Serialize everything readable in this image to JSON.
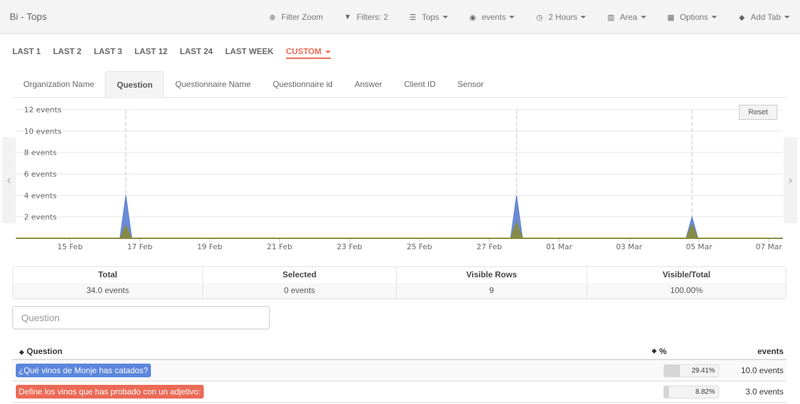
{
  "app": {
    "title": "Bi - Tops"
  },
  "topnav": [
    {
      "icon": "search-plus-icon",
      "glyph": "⊕",
      "label": "Filter Zoom",
      "dropdown": false
    },
    {
      "icon": "filter-icon",
      "glyph": "▼",
      "label": "Filters: 2",
      "dropdown": false
    },
    {
      "icon": "list-icon",
      "glyph": "☰",
      "label": "Tops",
      "dropdown": true
    },
    {
      "icon": "dashboard-icon",
      "glyph": "◉",
      "label": "events",
      "dropdown": true
    },
    {
      "icon": "clock-icon",
      "glyph": "◷",
      "label": "2 Hours",
      "dropdown": true
    },
    {
      "icon": "bar-chart-icon",
      "glyph": "▥",
      "label": "Area",
      "dropdown": true
    },
    {
      "icon": "grid-icon",
      "glyph": "▦",
      "label": "Options",
      "dropdown": true
    },
    {
      "icon": "tags-icon",
      "glyph": "◆",
      "label": "Add Tab",
      "dropdown": true
    }
  ],
  "quick_ranges": [
    {
      "label": "LAST 1",
      "active": false
    },
    {
      "label": "LAST 2",
      "active": false
    },
    {
      "label": "LAST 3",
      "active": false
    },
    {
      "label": "LAST 12",
      "active": false
    },
    {
      "label": "LAST 24",
      "active": false
    },
    {
      "label": "LAST WEEK",
      "active": false
    },
    {
      "label": "CUSTOM",
      "active": true
    }
  ],
  "tabs": [
    {
      "label": "Organization Name",
      "active": false
    },
    {
      "label": "Question",
      "active": true
    },
    {
      "label": "Questionnaire Name",
      "active": false
    },
    {
      "label": "Questionnaire id",
      "active": false
    },
    {
      "label": "Answer",
      "active": false
    },
    {
      "label": "Client ID",
      "active": false
    },
    {
      "label": "Sensor",
      "active": false
    }
  ],
  "chart": {
    "reset_label": "Reset",
    "prev_glyph": "‹",
    "next_glyph": "›"
  },
  "chart_data": {
    "type": "area",
    "title": "",
    "xlabel": "",
    "ylabel": "",
    "x_ticks": [
      "15 Feb",
      "17 Feb",
      "19 Feb",
      "21 Feb",
      "23 Feb",
      "25 Feb",
      "27 Feb",
      "01 Mar",
      "03 Mar",
      "05 Mar",
      "07 Mar"
    ],
    "x_range_days": [
      -1.55,
      20.4
    ],
    "x_tick_days": [
      0,
      2,
      4,
      6,
      8,
      10,
      12,
      14,
      16,
      18,
      20
    ],
    "y_ticks": [
      "2 events",
      "4 events",
      "6 events",
      "8 events",
      "10 events",
      "12 events"
    ],
    "y_tick_values": [
      2,
      4,
      6,
      8,
      10,
      12
    ],
    "ylim": [
      0,
      12
    ],
    "grid": true,
    "series": [
      {
        "name": "¿Qué vinos de Monje has catados?",
        "color": "#5b7fd1",
        "points": [
          {
            "day": 1.6,
            "value": 4
          },
          {
            "day": 12.78,
            "value": 4
          },
          {
            "day": 17.8,
            "value": 2
          }
        ]
      },
      {
        "name": "Define los vinos que has probado con un adjetivo:",
        "color": "#8a8a3a",
        "points": [
          {
            "day": 1.6,
            "value": 1.2
          },
          {
            "day": 12.78,
            "value": 1.5
          },
          {
            "day": 17.8,
            "value": 1.3
          }
        ]
      }
    ],
    "selection_markers_days": [
      1.6,
      12.78,
      17.8
    ]
  },
  "stats": [
    {
      "label": "Total",
      "value": "34.0 events"
    },
    {
      "label": "Selected",
      "value": "0 events"
    },
    {
      "label": "Visible Rows",
      "value": "9"
    },
    {
      "label": "Visible/Total",
      "value": "100.00%"
    }
  ],
  "search": {
    "placeholder": "Question",
    "value": ""
  },
  "table": {
    "headers": {
      "question": "Question",
      "percent": "%",
      "events": "events"
    },
    "rows": [
      {
        "question": "¿Qué vinos de Monje has catados?",
        "color": "#5b86dc",
        "percent_label": "29.41%",
        "percent": 29.41,
        "events": "10.0 events"
      },
      {
        "question": "Define los vinos que has probado con un adjetivo:",
        "color": "#ec6a55",
        "percent_label": "8.82%",
        "percent": 8.82,
        "events": "3.0 events"
      }
    ]
  }
}
